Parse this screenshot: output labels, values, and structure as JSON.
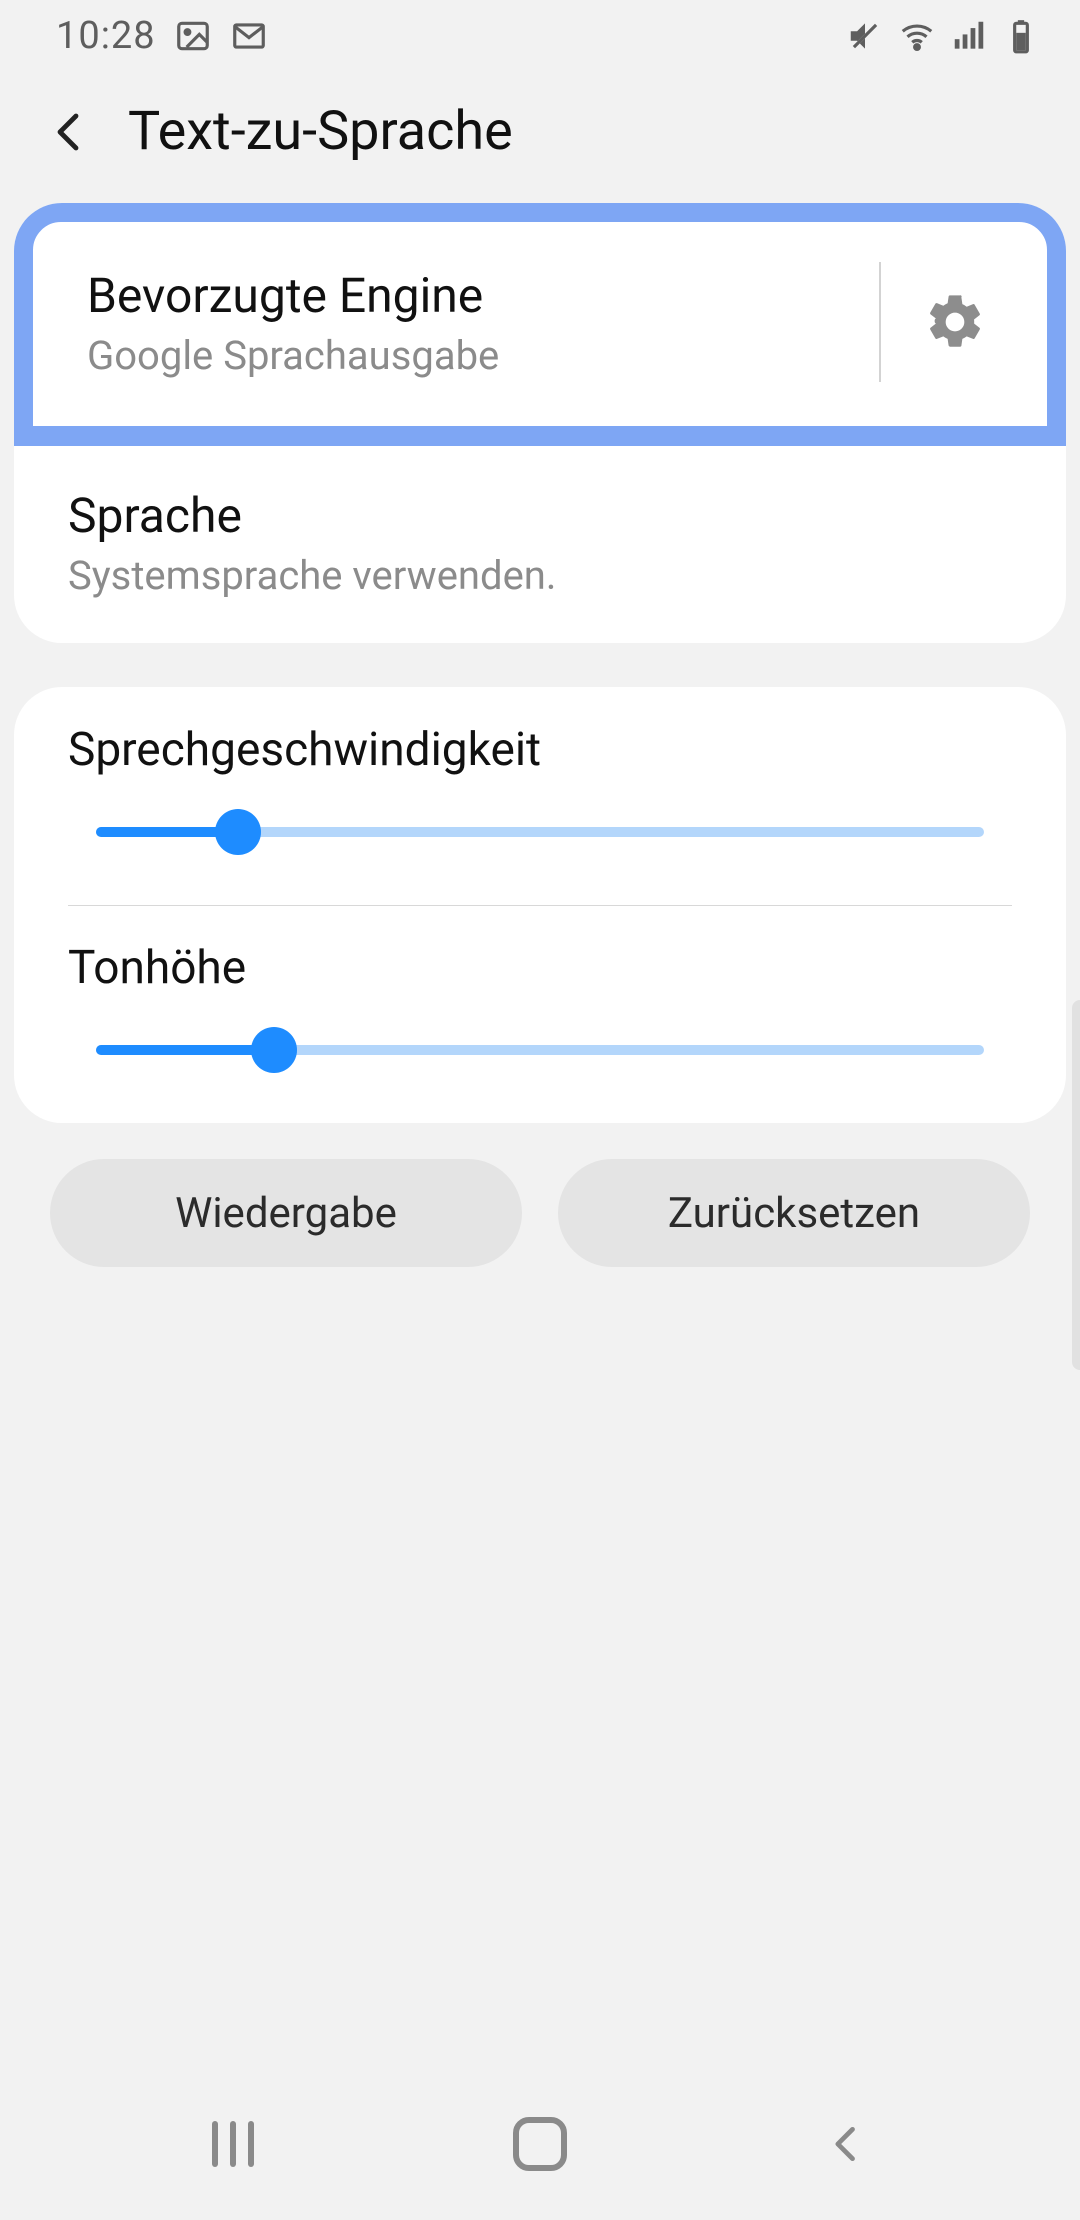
{
  "status": {
    "time": "10:28"
  },
  "header": {
    "title": "Text-zu-Sprache"
  },
  "settings": {
    "engine": {
      "title": "Bevorzugte Engine",
      "subtitle": "Google Sprachausgabe"
    },
    "language": {
      "title": "Sprache",
      "subtitle": "Systemsprache verwenden."
    },
    "speed": {
      "label": "Sprechgeschwindigkeit",
      "percent": 16
    },
    "pitch": {
      "label": "Tonhöhe",
      "percent": 20
    }
  },
  "buttons": {
    "play": "Wiedergabe",
    "reset": "Zurücksetzen"
  }
}
